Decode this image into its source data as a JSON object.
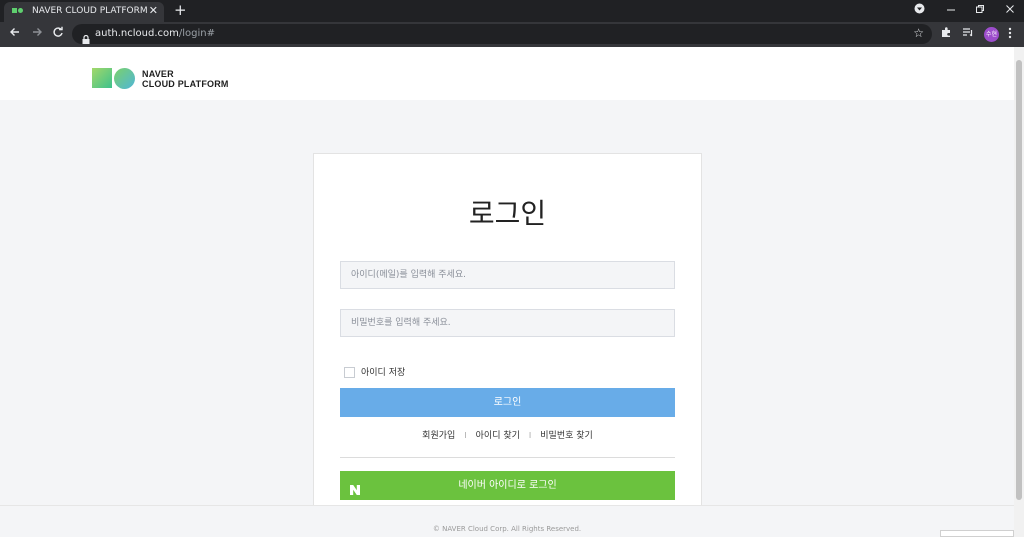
{
  "browser": {
    "tab_title": "NAVER CLOUD PLATFORM",
    "tab_close": "✕",
    "new_tab": "+",
    "url_host": "auth.ncloud.com",
    "url_path": "/login#",
    "profile_initials": "수현",
    "icons": [
      "favicon",
      "close-icon",
      "plus-icon",
      "media-icon",
      "minimize-icon",
      "restore-icon",
      "close-window-icon",
      "back-arrow-icon",
      "forward-arrow-icon",
      "reload-icon",
      "lock-icon",
      "star-icon",
      "extensions-icon",
      "reading-list-icon",
      "more-menu-icon"
    ]
  },
  "header": {
    "logo_line1": "NAVER",
    "logo_line2": "CLOUD PLATFORM"
  },
  "login": {
    "title": "로그인",
    "id_placeholder": "아이디(메일)를 입력해 주세요.",
    "id_value": "",
    "password_placeholder": "비밀번호를 입력해 주세요.",
    "password_value": "",
    "remember_label": "아이디 저장",
    "remember_checked": false,
    "login_button": "로그인",
    "links": {
      "signup": "회원가입",
      "find_id": "아이디 찾기",
      "find_password": "비밀번호 찾기",
      "separator": "I"
    },
    "naver_login_button": "네이버 아이디로 로그인"
  },
  "footer": {
    "copyright": "© NAVER Cloud Corp. All Rights Reserved."
  },
  "colors": {
    "login_button": "#68ace8",
    "naver_button": "#6bc23e",
    "page_background": "#f4f5f7"
  }
}
